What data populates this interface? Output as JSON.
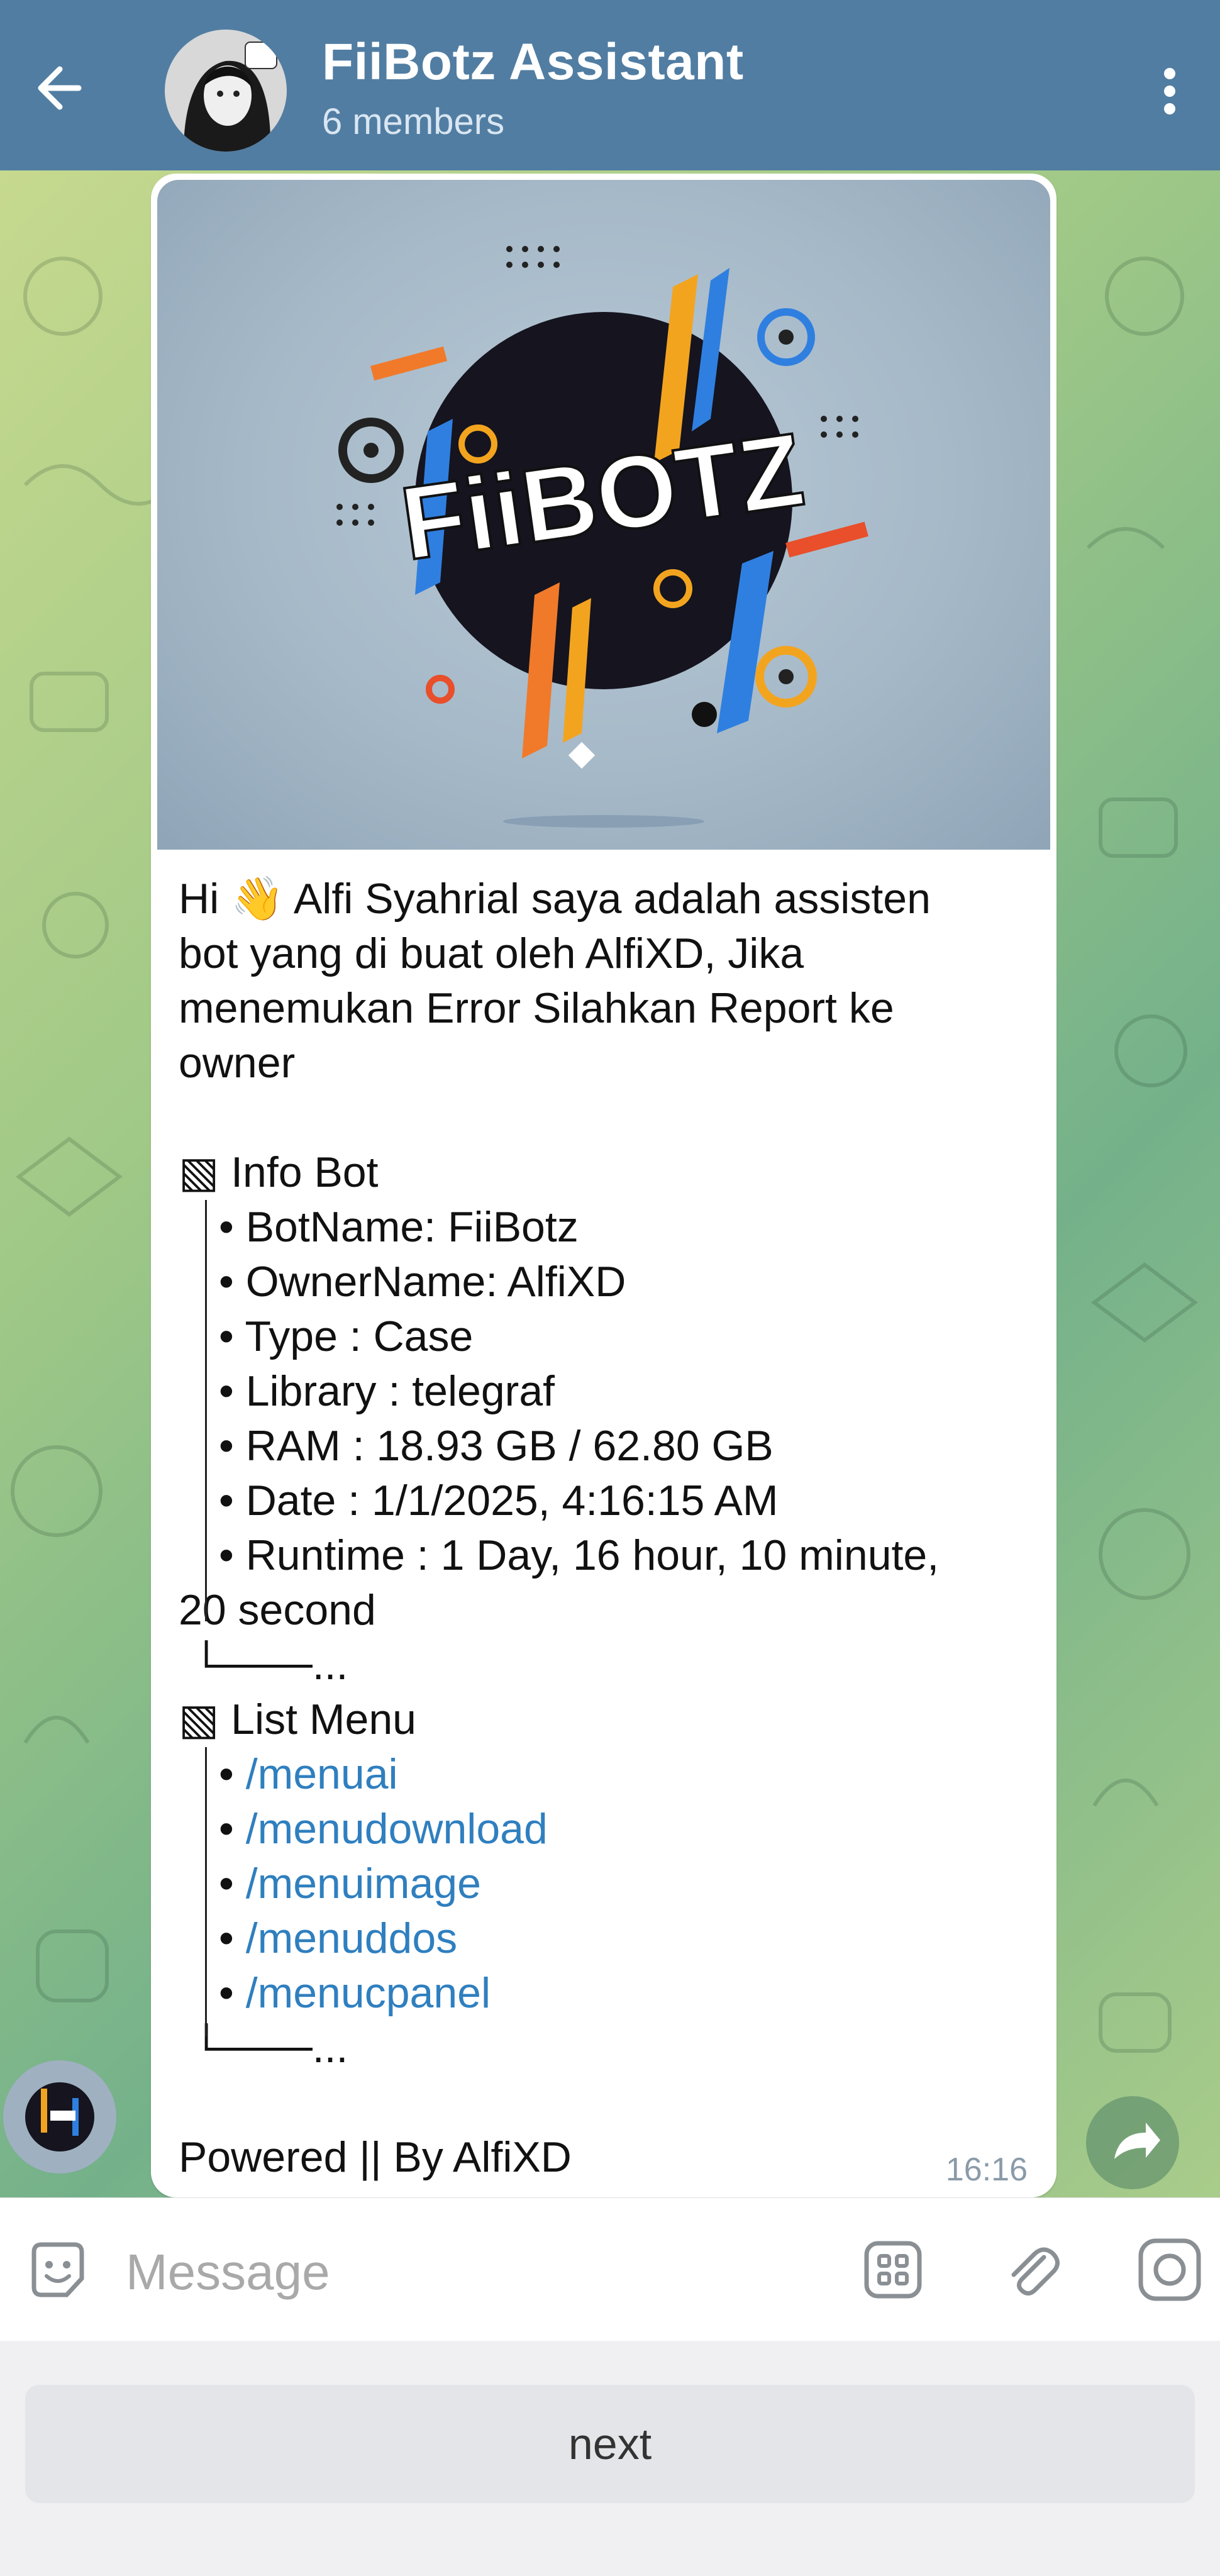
{
  "header": {
    "title": "FiiBotz Assistant",
    "subtitle": "6 members"
  },
  "banner": {
    "logo_text": "FiiBOTZ"
  },
  "message": {
    "greeting_lines": [
      "Hi 👋 Alfi Syahrial saya adalah assisten",
      "bot yang di buat oleh AlfiXD, Jika",
      "menemukan Error Silahkan Report ke",
      "owner"
    ],
    "info_heading": "▧  Info Bot",
    "info_items": [
      "• BotName: FiiBotz",
      "• OwnerName: AlfiXD",
      "• Type : Case",
      "• Library : telegraf",
      "• RAM : 18.93 GB / 62.80 GB",
      "• Date : 1/1/2025, 4:16:15 AM",
      "• Runtime : 1 Day, 16 hour, 10 minute,"
    ],
    "info_wrap": "20 second",
    "info_end": "└───...",
    "menu_heading": "▧ List Menu",
    "menu_bullet": "• ",
    "menu_items": [
      "/menuai",
      "/menudownload",
      "/menuimage",
      "/menuddos",
      "/menucpanel"
    ],
    "menu_end": "└───...",
    "footer": "Powered || By AlfiXD",
    "time": "16:16"
  },
  "input": {
    "placeholder": "Message"
  },
  "keyboard": {
    "next_label": "next"
  },
  "colors": {
    "header_bg": "#517da2",
    "link": "#2f7fbf",
    "chat_bg_start": "#c6d98e",
    "chat_bg_end": "#74b18a"
  }
}
